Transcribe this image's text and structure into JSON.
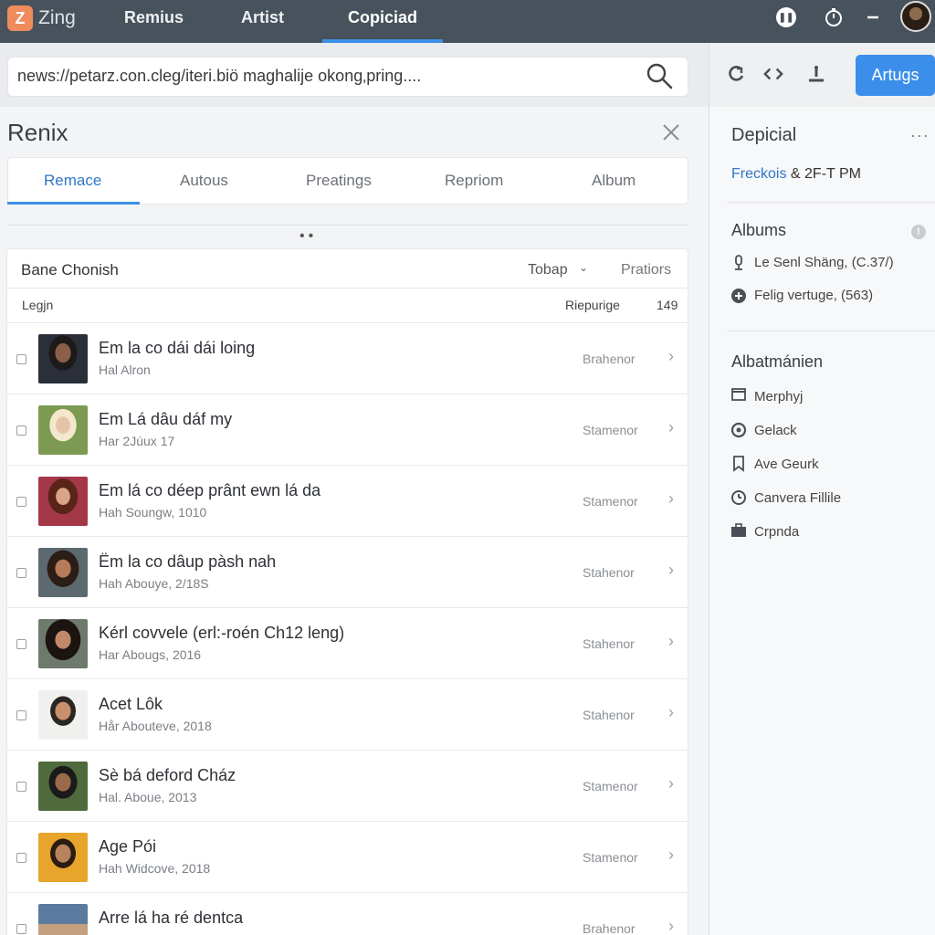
{
  "topnav": {
    "logo_glyph": "Z",
    "brand": "Zing",
    "tabs": [
      "Remius",
      "Artist",
      "Copiciad"
    ],
    "icons": [
      "pause-icon",
      "timer-icon",
      "minus-icon",
      "avatar"
    ]
  },
  "address": {
    "url": "news://petarz.con.cleg/iteri.biö maghalije okong‚pring...."
  },
  "toolbar": {
    "button_label": "Artugs",
    "icons": [
      "back-icon",
      "code-icon",
      "download-icon"
    ]
  },
  "main": {
    "title": "Renix",
    "tabs": [
      "Remace",
      "Autous",
      "Preatings",
      "Repriom",
      "Album"
    ],
    "list": {
      "title": "Bane Chonish",
      "sort_label": "Tobap",
      "right_label": "Pratiors",
      "col_left": "Legjn",
      "col_mid": "Riepurige",
      "col_count": "149"
    },
    "rows": [
      {
        "title": "Em la co dái dái loing",
        "sub": "Hal Alron",
        "tag": "Brahenor"
      },
      {
        "title": "Em Lá dâu dáf my",
        "sub": "Har 2Júux 17",
        "tag": "Stamenor"
      },
      {
        "title": "Em lá co déep prânt ewn lá da",
        "sub": "Hah Soungw, 1010",
        "tag": "Stamenor"
      },
      {
        "title": "Ëm la co dâup pàsh nah",
        "sub": "Hah Abouye, 2/18S",
        "tag": "Stahenor"
      },
      {
        "title": "Kérl covvele (erl:-roén Ch12 leng)",
        "sub": "Har Abougs, 2016",
        "tag": "Stahenor"
      },
      {
        "title": "Acet Lôk",
        "sub": "Hår Abouteve, 2018",
        "tag": "Stahenor"
      },
      {
        "title": "Sè bá deford Cház",
        "sub": "Hal. Aboue, 2013",
        "tag": "Stamenor"
      },
      {
        "title": "Age Pói",
        "sub": "Hah Widcove, 2018",
        "tag": "Stamenor"
      },
      {
        "title": "Arre lá ha ré dentca",
        "sub": "",
        "tag": "Brahenor"
      }
    ]
  },
  "side": {
    "title": "Depicial",
    "sub_accent": "Freckois",
    "sub_rest": " & 2F-T PM",
    "albums_title": "Albums",
    "albums": [
      {
        "label": "Le Senl Shäng, (C.37/)",
        "icon": "mic-icon"
      },
      {
        "label": "Felig vertuge, (563)",
        "icon": "plus-circle-icon"
      }
    ],
    "section2_title": "Albatmánien",
    "items": [
      {
        "label": "Merphyj",
        "icon": "window-icon"
      },
      {
        "label": "Gelack",
        "icon": "refresh-icon"
      },
      {
        "label": "Ave Geurk",
        "icon": "bookmark-icon"
      },
      {
        "label": "Canvera Fillile",
        "icon": "clock-icon"
      },
      {
        "label": "Crpnda",
        "icon": "briefcase-icon"
      }
    ]
  },
  "colors": {
    "nav_bg": "#47525c",
    "accent": "#3b8fea",
    "logo": "#f08b5c"
  }
}
